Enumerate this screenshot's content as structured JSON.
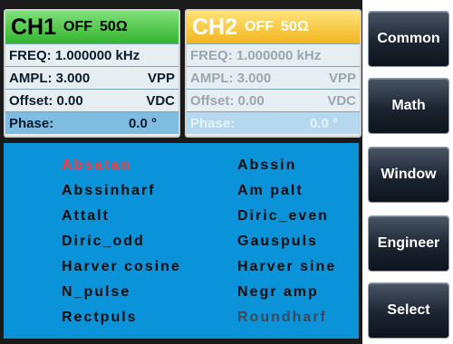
{
  "ch1": {
    "name": "CH1",
    "state": "OFF",
    "impedance": "50Ω",
    "freq": "FREQ: 1.000000 kHz",
    "ampl_label": "AMPL: 3.000",
    "ampl_unit": "VPP",
    "offset_label": "Offset:  0.00",
    "offset_unit": "VDC",
    "phase_label": "Phase:",
    "phase_value": "0.0 °"
  },
  "ch2": {
    "name": "CH2",
    "state": "OFF",
    "impedance": "50Ω",
    "freq": "FREQ: 1.000000 kHz",
    "ampl_label": "AMPL: 3.000",
    "ampl_unit": "VPP",
    "offset_label": "Offset:  0.00",
    "offset_unit": "VDC",
    "phase_label": "Phase:",
    "phase_value": "0.0 °"
  },
  "waveforms": {
    "left": [
      "Absatan",
      "Abssinharf",
      "Attalt",
      "Diric_odd",
      "Harver cosine",
      "N_pulse",
      "Rectpuls"
    ],
    "right": [
      "Abssin",
      "Am palt",
      "Diric_even",
      "Gauspuls",
      "Harver sine",
      "Negr amp",
      "Roundharf"
    ]
  },
  "softkeys": [
    "Common",
    "Math",
    "Window",
    "Engineer",
    "Select"
  ]
}
